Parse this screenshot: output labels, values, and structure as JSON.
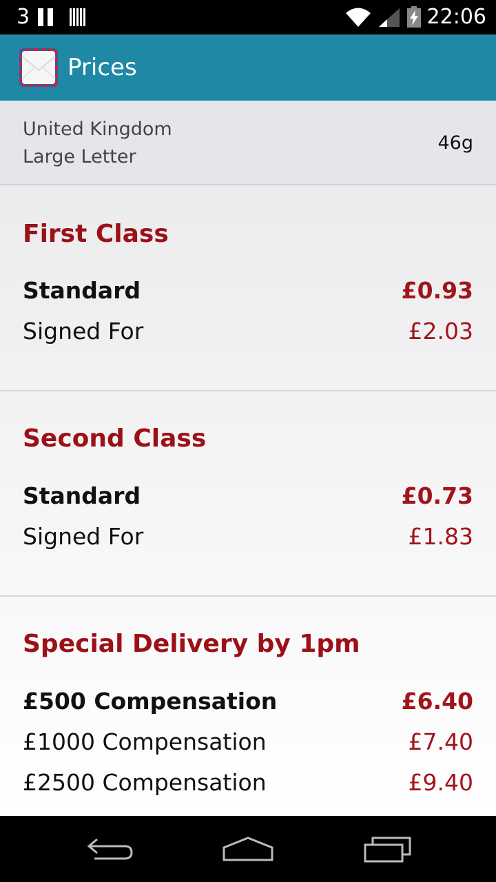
{
  "status_bar": {
    "carrier_number": "3",
    "time": "22:06"
  },
  "app_bar": {
    "title": "Prices",
    "icon": "envelope-icon"
  },
  "summary": {
    "country": "United Kingdom",
    "item_type": "Large Letter",
    "weight": "46g"
  },
  "sections": [
    {
      "title": "First Class",
      "rows": [
        {
          "label": "Standard",
          "price": "£0.93"
        },
        {
          "label": "Signed For",
          "price": "£2.03"
        }
      ]
    },
    {
      "title": "Second Class",
      "rows": [
        {
          "label": "Standard",
          "price": "£0.73"
        },
        {
          "label": "Signed For",
          "price": "£1.83"
        }
      ]
    },
    {
      "title": "Special Delivery by 1pm",
      "rows": [
        {
          "label": "£500 Compensation",
          "price": "£6.40"
        },
        {
          "label": "£1000 Compensation",
          "price": "£7.40"
        },
        {
          "label": "£2500 Compensation",
          "price": "£9.40"
        }
      ]
    }
  ],
  "colors": {
    "app_bar": "#1f88a5",
    "accent_red": "#9c1018"
  },
  "nav": {
    "back": "back-icon",
    "home": "home-icon",
    "recents": "recents-icon"
  }
}
